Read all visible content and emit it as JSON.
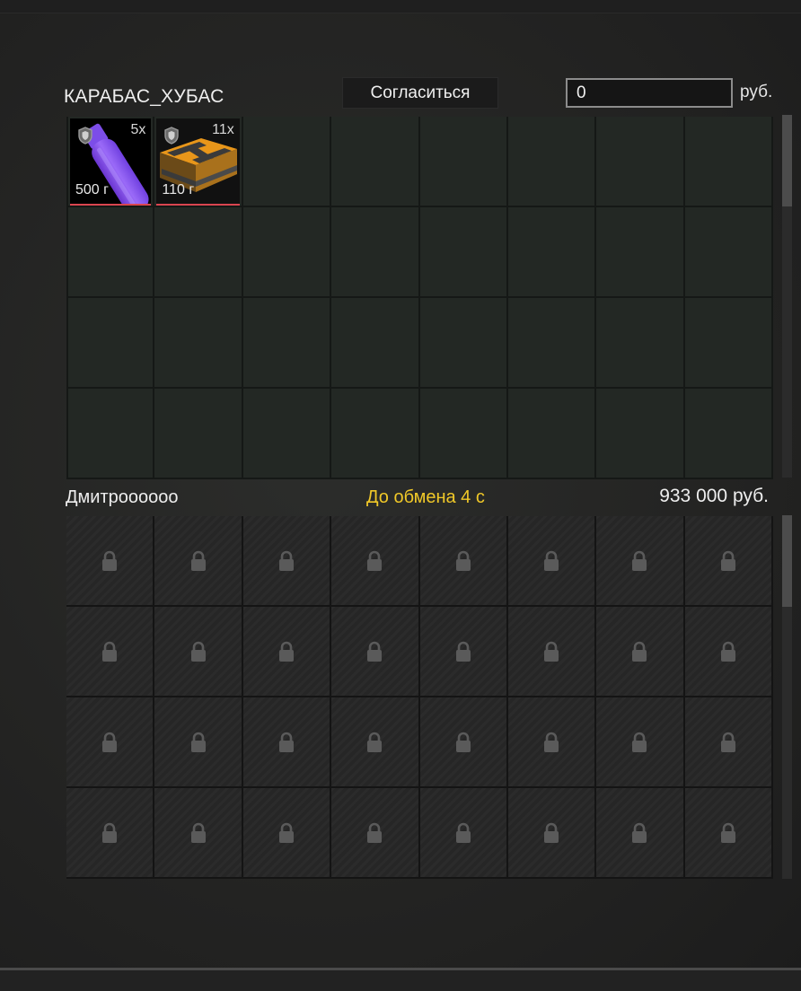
{
  "own": {
    "name": "КАРАБАС_ХУБАС",
    "agree_label": "Согласиться",
    "money_value": "0",
    "currency": "руб.",
    "items": [
      {
        "count": "5x",
        "weight": "500 г",
        "icon": "glowstick-icon"
      },
      {
        "count": "11x",
        "weight": "110 г",
        "icon": "ammo-box-icon"
      }
    ]
  },
  "partner": {
    "name": "Дмитроооооо",
    "timer": "До обмена 4 с",
    "money": "933 000 руб."
  },
  "colors": {
    "timer": "#f0c828",
    "item_border": "#d9454f",
    "glowstick": "#8a55f0",
    "ammo_box": "#f0a020"
  }
}
